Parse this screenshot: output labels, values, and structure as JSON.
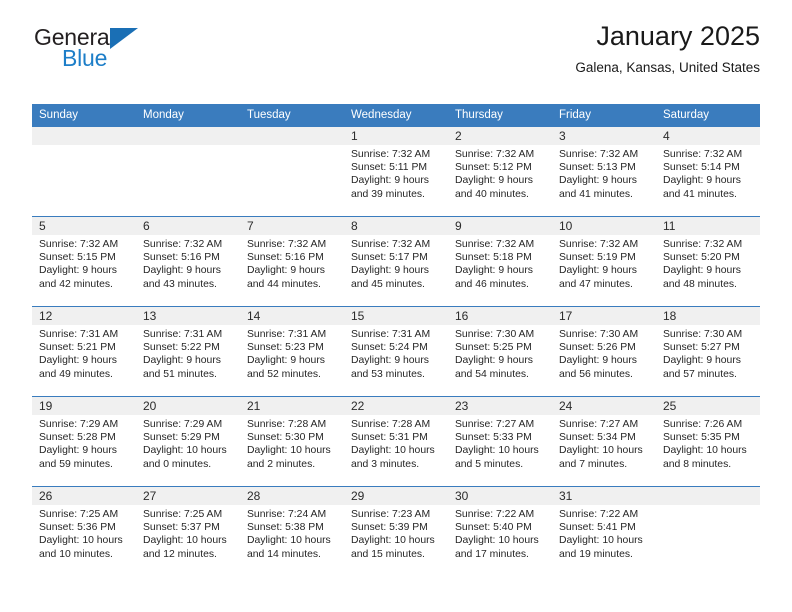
{
  "brand": {
    "name_part1": "General",
    "name_part2": "Blue",
    "triangle_icon": "triangle-logo-icon",
    "blue": "#1d7ec8",
    "dark": "#231f20"
  },
  "header": {
    "title": "January 2025",
    "subtitle": "Galena, Kansas, United States"
  },
  "calendar": {
    "header_bg": "#3a7cbe",
    "header_text": "#ffffff",
    "daynum_bg": "#f0f0f0",
    "weekday_headers": [
      "Sunday",
      "Monday",
      "Tuesday",
      "Wednesday",
      "Thursday",
      "Friday",
      "Saturday"
    ],
    "weeks": [
      [
        {
          "day": "",
          "empty": true
        },
        {
          "day": "",
          "empty": true
        },
        {
          "day": "",
          "empty": true
        },
        {
          "day": "1",
          "sunrise": "Sunrise: 7:32 AM",
          "sunset": "Sunset: 5:11 PM",
          "daylight1": "Daylight: 9 hours",
          "daylight2": "and 39 minutes."
        },
        {
          "day": "2",
          "sunrise": "Sunrise: 7:32 AM",
          "sunset": "Sunset: 5:12 PM",
          "daylight1": "Daylight: 9 hours",
          "daylight2": "and 40 minutes."
        },
        {
          "day": "3",
          "sunrise": "Sunrise: 7:32 AM",
          "sunset": "Sunset: 5:13 PM",
          "daylight1": "Daylight: 9 hours",
          "daylight2": "and 41 minutes."
        },
        {
          "day": "4",
          "sunrise": "Sunrise: 7:32 AM",
          "sunset": "Sunset: 5:14 PM",
          "daylight1": "Daylight: 9 hours",
          "daylight2": "and 41 minutes."
        }
      ],
      [
        {
          "day": "5",
          "sunrise": "Sunrise: 7:32 AM",
          "sunset": "Sunset: 5:15 PM",
          "daylight1": "Daylight: 9 hours",
          "daylight2": "and 42 minutes."
        },
        {
          "day": "6",
          "sunrise": "Sunrise: 7:32 AM",
          "sunset": "Sunset: 5:16 PM",
          "daylight1": "Daylight: 9 hours",
          "daylight2": "and 43 minutes."
        },
        {
          "day": "7",
          "sunrise": "Sunrise: 7:32 AM",
          "sunset": "Sunset: 5:16 PM",
          "daylight1": "Daylight: 9 hours",
          "daylight2": "and 44 minutes."
        },
        {
          "day": "8",
          "sunrise": "Sunrise: 7:32 AM",
          "sunset": "Sunset: 5:17 PM",
          "daylight1": "Daylight: 9 hours",
          "daylight2": "and 45 minutes."
        },
        {
          "day": "9",
          "sunrise": "Sunrise: 7:32 AM",
          "sunset": "Sunset: 5:18 PM",
          "daylight1": "Daylight: 9 hours",
          "daylight2": "and 46 minutes."
        },
        {
          "day": "10",
          "sunrise": "Sunrise: 7:32 AM",
          "sunset": "Sunset: 5:19 PM",
          "daylight1": "Daylight: 9 hours",
          "daylight2": "and 47 minutes."
        },
        {
          "day": "11",
          "sunrise": "Sunrise: 7:32 AM",
          "sunset": "Sunset: 5:20 PM",
          "daylight1": "Daylight: 9 hours",
          "daylight2": "and 48 minutes."
        }
      ],
      [
        {
          "day": "12",
          "sunrise": "Sunrise: 7:31 AM",
          "sunset": "Sunset: 5:21 PM",
          "daylight1": "Daylight: 9 hours",
          "daylight2": "and 49 minutes."
        },
        {
          "day": "13",
          "sunrise": "Sunrise: 7:31 AM",
          "sunset": "Sunset: 5:22 PM",
          "daylight1": "Daylight: 9 hours",
          "daylight2": "and 51 minutes."
        },
        {
          "day": "14",
          "sunrise": "Sunrise: 7:31 AM",
          "sunset": "Sunset: 5:23 PM",
          "daylight1": "Daylight: 9 hours",
          "daylight2": "and 52 minutes."
        },
        {
          "day": "15",
          "sunrise": "Sunrise: 7:31 AM",
          "sunset": "Sunset: 5:24 PM",
          "daylight1": "Daylight: 9 hours",
          "daylight2": "and 53 minutes."
        },
        {
          "day": "16",
          "sunrise": "Sunrise: 7:30 AM",
          "sunset": "Sunset: 5:25 PM",
          "daylight1": "Daylight: 9 hours",
          "daylight2": "and 54 minutes."
        },
        {
          "day": "17",
          "sunrise": "Sunrise: 7:30 AM",
          "sunset": "Sunset: 5:26 PM",
          "daylight1": "Daylight: 9 hours",
          "daylight2": "and 56 minutes."
        },
        {
          "day": "18",
          "sunrise": "Sunrise: 7:30 AM",
          "sunset": "Sunset: 5:27 PM",
          "daylight1": "Daylight: 9 hours",
          "daylight2": "and 57 minutes."
        }
      ],
      [
        {
          "day": "19",
          "sunrise": "Sunrise: 7:29 AM",
          "sunset": "Sunset: 5:28 PM",
          "daylight1": "Daylight: 9 hours",
          "daylight2": "and 59 minutes."
        },
        {
          "day": "20",
          "sunrise": "Sunrise: 7:29 AM",
          "sunset": "Sunset: 5:29 PM",
          "daylight1": "Daylight: 10 hours",
          "daylight2": "and 0 minutes."
        },
        {
          "day": "21",
          "sunrise": "Sunrise: 7:28 AM",
          "sunset": "Sunset: 5:30 PM",
          "daylight1": "Daylight: 10 hours",
          "daylight2": "and 2 minutes."
        },
        {
          "day": "22",
          "sunrise": "Sunrise: 7:28 AM",
          "sunset": "Sunset: 5:31 PM",
          "daylight1": "Daylight: 10 hours",
          "daylight2": "and 3 minutes."
        },
        {
          "day": "23",
          "sunrise": "Sunrise: 7:27 AM",
          "sunset": "Sunset: 5:33 PM",
          "daylight1": "Daylight: 10 hours",
          "daylight2": "and 5 minutes."
        },
        {
          "day": "24",
          "sunrise": "Sunrise: 7:27 AM",
          "sunset": "Sunset: 5:34 PM",
          "daylight1": "Daylight: 10 hours",
          "daylight2": "and 7 minutes."
        },
        {
          "day": "25",
          "sunrise": "Sunrise: 7:26 AM",
          "sunset": "Sunset: 5:35 PM",
          "daylight1": "Daylight: 10 hours",
          "daylight2": "and 8 minutes."
        }
      ],
      [
        {
          "day": "26",
          "sunrise": "Sunrise: 7:25 AM",
          "sunset": "Sunset: 5:36 PM",
          "daylight1": "Daylight: 10 hours",
          "daylight2": "and 10 minutes."
        },
        {
          "day": "27",
          "sunrise": "Sunrise: 7:25 AM",
          "sunset": "Sunset: 5:37 PM",
          "daylight1": "Daylight: 10 hours",
          "daylight2": "and 12 minutes."
        },
        {
          "day": "28",
          "sunrise": "Sunrise: 7:24 AM",
          "sunset": "Sunset: 5:38 PM",
          "daylight1": "Daylight: 10 hours",
          "daylight2": "and 14 minutes."
        },
        {
          "day": "29",
          "sunrise": "Sunrise: 7:23 AM",
          "sunset": "Sunset: 5:39 PM",
          "daylight1": "Daylight: 10 hours",
          "daylight2": "and 15 minutes."
        },
        {
          "day": "30",
          "sunrise": "Sunrise: 7:22 AM",
          "sunset": "Sunset: 5:40 PM",
          "daylight1": "Daylight: 10 hours",
          "daylight2": "and 17 minutes."
        },
        {
          "day": "31",
          "sunrise": "Sunrise: 7:22 AM",
          "sunset": "Sunset: 5:41 PM",
          "daylight1": "Daylight: 10 hours",
          "daylight2": "and 19 minutes."
        },
        {
          "day": "",
          "empty": true
        }
      ]
    ]
  }
}
